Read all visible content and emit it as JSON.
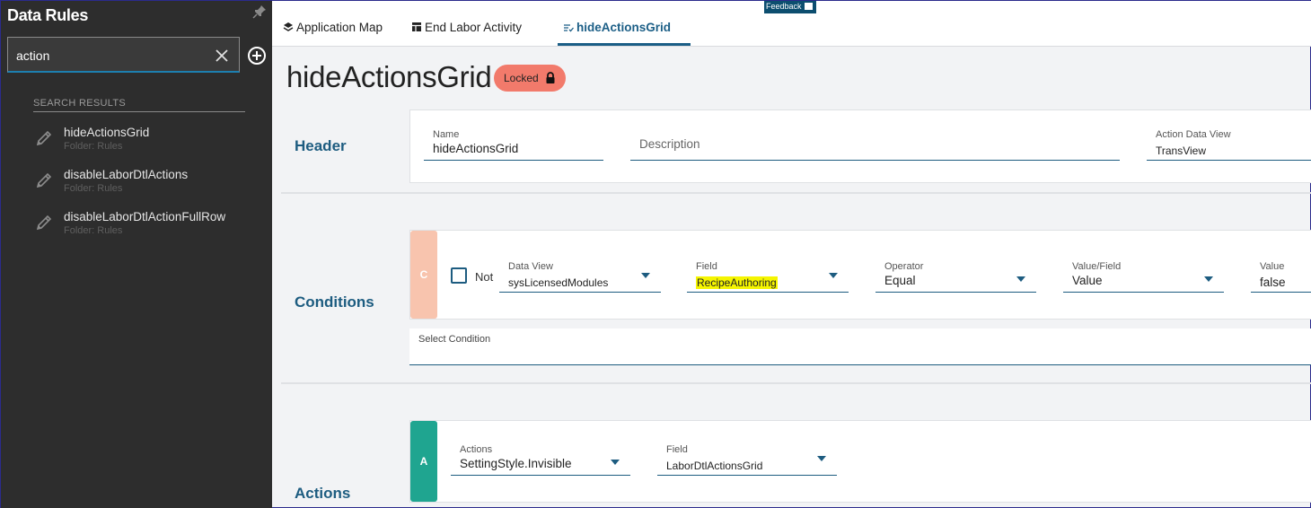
{
  "sidebar": {
    "title": "Data Rules",
    "search": {
      "value": "action"
    },
    "results_label": "SEARCH RESULTS",
    "results": [
      {
        "name": "hideActionsGrid",
        "folder": "Folder: Rules"
      },
      {
        "name": "disableLaborDtlActions",
        "folder": "Folder: Rules"
      },
      {
        "name": "disableLaborDtlActionFullRow",
        "folder": "Folder: Rules"
      }
    ]
  },
  "topnav": {
    "tabs": [
      {
        "label": "Application Map",
        "icon": "layers-icon"
      },
      {
        "label": "End Labor Activity",
        "icon": "table-icon"
      },
      {
        "label": "hideActionsGrid",
        "icon": "rule-list-icon",
        "active": true
      }
    ],
    "feedback_label": "Feedback"
  },
  "main": {
    "title": "hideActionsGrid",
    "status_badge": "Locked",
    "header": {
      "label": "Header",
      "name_label": "Name",
      "name_value": "hideActionsGrid",
      "description_placeholder": "Description",
      "action_data_view_label": "Action Data View",
      "action_data_view_value": "TransView"
    },
    "conditions": {
      "label": "Conditions",
      "badge": "C",
      "not_label": "Not",
      "data_view_label": "Data View",
      "data_view_value": "sysLicensedModules",
      "field_label": "Field",
      "field_value": "RecipeAuthoring",
      "operator_label": "Operator",
      "operator_value": "Equal",
      "value_field_label": "Value/Field",
      "value_field_value": "Value",
      "value_label": "Value",
      "value_value": "false",
      "select_condition_label": "Select Condition"
    },
    "actions": {
      "label": "Actions",
      "badge": "A",
      "actions_label": "Actions",
      "actions_value": "SettingStyle.Invisible",
      "field_label": "Field",
      "field_value": "LaborDtlActionsGrid"
    }
  },
  "colors": {
    "sidebar_bg": "#2d2d2d",
    "accent": "#1d5c80",
    "locked_badge": "#f27a6b",
    "condition_badge": "#f8c4ae",
    "action_badge": "#1fa590",
    "highlight": "#f5f500"
  }
}
